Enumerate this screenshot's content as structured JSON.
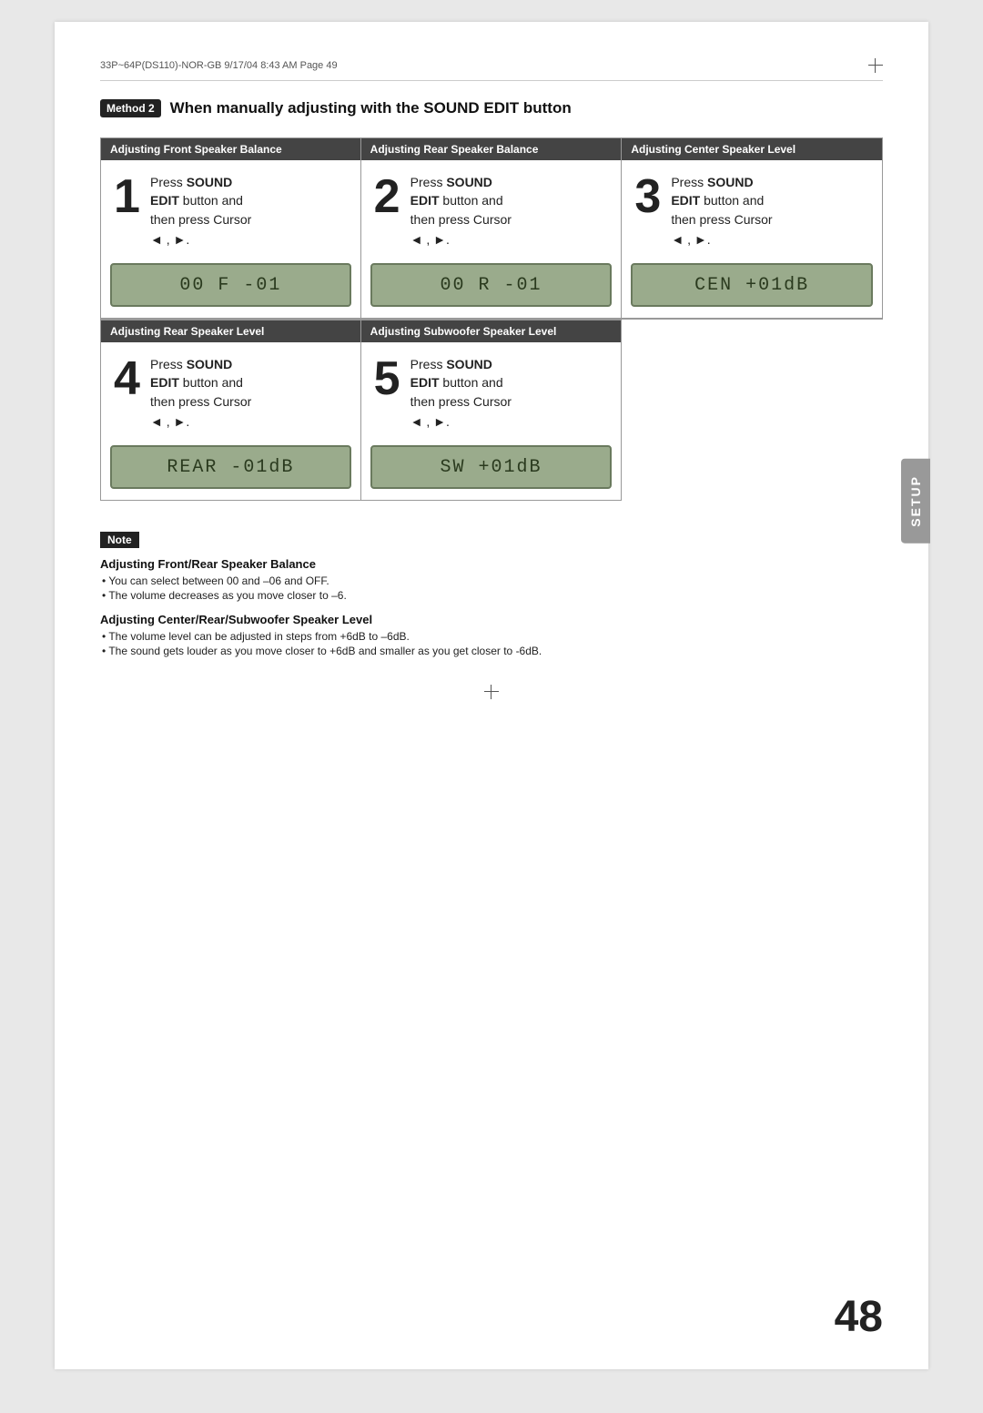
{
  "print_header": {
    "text": "33P~64P(DS110)-NOR-GB   9/17/04  8:43 AM   Page 49"
  },
  "method": {
    "badge": "Method 2",
    "title": "When manually adjusting with the SOUND EDIT button"
  },
  "sections_top": [
    {
      "id": "front-balance",
      "header": "Adjusting Front Speaker Balance",
      "step_number": "1",
      "instruction_prefix": "Press ",
      "instruction_bold1": "SOUND",
      "instruction_mid": " button and",
      "instruction_bold2": "EDIT",
      "instruction_suffix": "then press Cursor",
      "cursor": "◄ , ►.",
      "lcd": "00 F  -01"
    },
    {
      "id": "rear-balance",
      "header": "Adjusting Rear Speaker Balance",
      "step_number": "2",
      "instruction_prefix": "Press ",
      "instruction_bold1": "SOUND",
      "instruction_mid": " button and",
      "instruction_bold2": "EDIT",
      "instruction_suffix": "then press Cursor",
      "cursor": "◄ , ►.",
      "lcd": "00 R  -01"
    },
    {
      "id": "center-level",
      "header": "Adjusting Center Speaker Level",
      "step_number": "3",
      "instruction_prefix": "Press ",
      "instruction_bold1": "SOUND",
      "instruction_mid": " button and",
      "instruction_bold2": "EDIT",
      "instruction_suffix": "then press Cursor",
      "cursor": "◄ , ►.",
      "lcd": "CEN  +01dB"
    }
  ],
  "sections_bottom": [
    {
      "id": "rear-level",
      "header": "Adjusting Rear Speaker Level",
      "step_number": "4",
      "instruction_prefix": "Press ",
      "instruction_bold1": "SOUND",
      "instruction_mid": " button and",
      "instruction_bold2": "EDIT",
      "instruction_suffix": "then press Cursor",
      "cursor": "◄ , ►.",
      "lcd": "REAR -01dB"
    },
    {
      "id": "subwoofer-level",
      "header": "Adjusting Subwoofer Speaker Level",
      "step_number": "5",
      "instruction_prefix": "Press ",
      "instruction_bold1": "SOUND",
      "instruction_mid": " button and",
      "instruction_bold2": "EDIT",
      "instruction_suffix": "then press Cursor",
      "cursor": "◄ , ►.",
      "lcd": "SW   +01dB"
    },
    {
      "id": "empty",
      "header": "",
      "step_number": "",
      "lcd": ""
    }
  ],
  "setup_tab": "SETUP",
  "note": {
    "badge": "Note",
    "blocks": [
      {
        "heading": "Adjusting Front/Rear Speaker Balance",
        "bullets": [
          "You can select between 00 and –06 and OFF.",
          "The volume decreases as you move closer to –6."
        ]
      },
      {
        "heading": "Adjusting Center/Rear/Subwoofer Speaker Level",
        "bullets": [
          "The volume level can be adjusted in steps from +6dB to –6dB.",
          "The sound gets louder as you move closer to +6dB and smaller as you get closer to -6dB."
        ]
      }
    ]
  },
  "page_number": "48"
}
